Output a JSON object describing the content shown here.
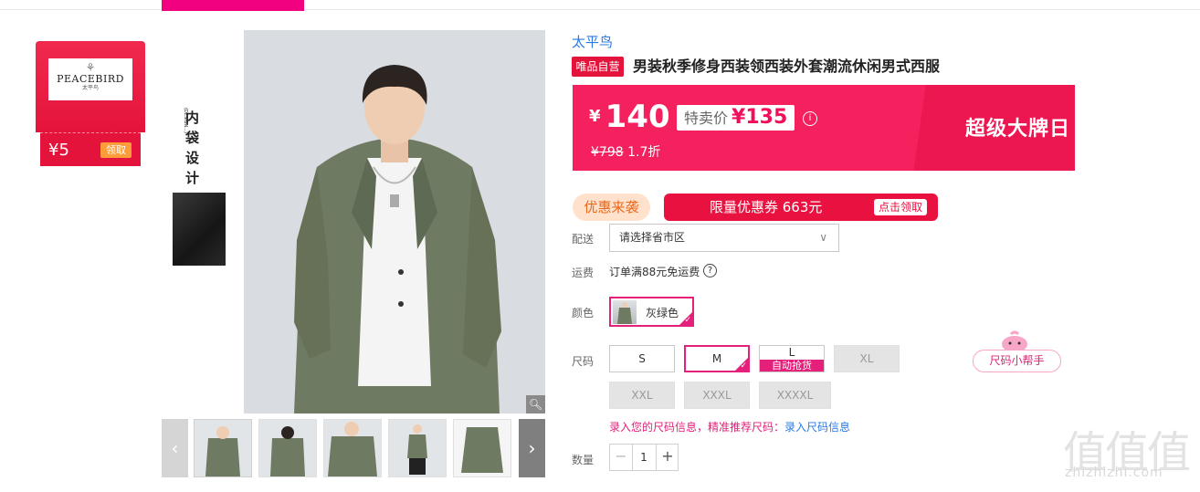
{
  "coupon": {
    "brand_name": "PEACEBIRD",
    "brand_cn": "太平鸟",
    "amount": "¥5",
    "claim_label": "领取"
  },
  "gallery": {
    "side_text": "内袋设计",
    "side_design_text": "(DESIGN...)",
    "zoom_icon": "magnifier-icon",
    "thumb_count": 5
  },
  "product": {
    "brand": "太平鸟",
    "self_tag": "唯品自营",
    "title": "男装秋季修身西装领西装外套潮流休闲男式西服"
  },
  "price": {
    "currency": "¥",
    "main": "140",
    "sale_label": "特卖价",
    "sale_value": "¥135",
    "original": "¥798",
    "discount": "1.7折",
    "event": "超级大牌日",
    "colors": {
      "bg": "#f5215e",
      "band": "#ec1651"
    }
  },
  "promo": {
    "tag": "优惠来袭",
    "banner_text": "限量优惠券 663元",
    "banner_button": "点击领取"
  },
  "delivery": {
    "label": "配送",
    "placeholder": "请选择省市区"
  },
  "shipping": {
    "label": "运费",
    "text": "订单满88元免运费"
  },
  "color": {
    "label": "颜色",
    "selected": "灰绿色"
  },
  "size": {
    "label": "尺码",
    "options": [
      {
        "name": "S",
        "state": "normal"
      },
      {
        "name": "M",
        "state": "selected"
      },
      {
        "name": "L",
        "state": "normal",
        "badge": "自动抢货"
      },
      {
        "name": "XL",
        "state": "disabled"
      },
      {
        "name": "XXL",
        "state": "disabled"
      },
      {
        "name": "XXXL",
        "state": "disabled"
      },
      {
        "name": "XXXXL",
        "state": "disabled"
      }
    ],
    "helper": "尺码小帮手",
    "hint": "录入您的尺码信息，精准推荐尺码：",
    "hint_link": "录入尺码信息"
  },
  "quantity": {
    "label": "数量",
    "value": "1",
    "minus": "−",
    "plus": "+"
  },
  "watermark": {
    "big": "值值值",
    "small": "zhizhizhi.com"
  },
  "accent": "#e4207a"
}
